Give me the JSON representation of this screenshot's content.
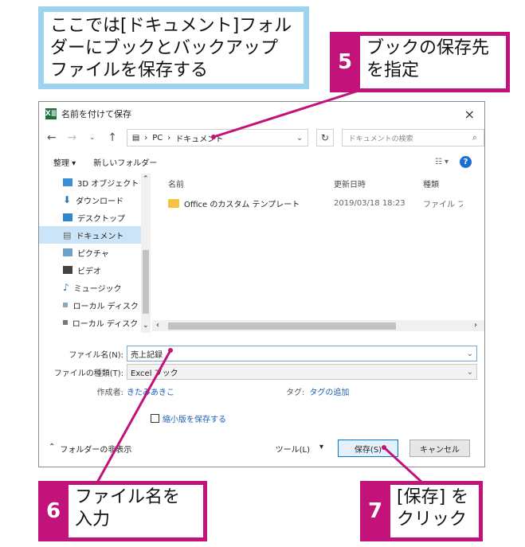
{
  "intro": {
    "line1": "ここでは[ドキュメント]フォル",
    "line2": "ダーにブックとバックアップ",
    "line3": "ファイルを保存する"
  },
  "steps": {
    "s5": {
      "num": "5",
      "line1": "ブックの保存先",
      "line2": "を指定"
    },
    "s6": {
      "num": "6",
      "line1": "ファイル名を",
      "line2": "入力"
    },
    "s7": {
      "num": "7",
      "line1": "[保存] を",
      "line2": "クリック"
    }
  },
  "dialog": {
    "app_icon": "X≣",
    "title": "名前を付けて保存",
    "close": "×",
    "address": {
      "crumbs": [
        "PC",
        "ドキュメント"
      ],
      "sep": "›"
    },
    "search_placeholder": "ドキュメントの検索",
    "command": {
      "organize": "整理 ▾",
      "new_folder": "新しいフォルダー",
      "view": "☷ ▾",
      "help": "?"
    },
    "nav_items": [
      "3D オブジェクト",
      "ダウンロード",
      "デスクトップ",
      "ドキュメント",
      "ピクチャ",
      "ビデオ",
      "ミュージック",
      "ローカル ディスク (C",
      "ローカル ディスク (D"
    ],
    "columns": {
      "name": "名前",
      "date": "更新日時",
      "type": "種類"
    },
    "files": [
      {
        "name": "Office のカスタム テンプレート",
        "date": "2019/03/18 18:23",
        "type": "ファイル フォ"
      }
    ],
    "filename_label": "ファイル名(N):",
    "filename_value": "売上記録",
    "filetype_label": "ファイルの種類(T):",
    "filetype_value": "Excel ブック",
    "author_label": "作成者:",
    "author_value": "きたみあきこ",
    "tags_label": "タグ:",
    "tags_value": "タグの追加",
    "thumbnail_label": "縮小版を保存する",
    "hide_folders": "フォルダーの非表示",
    "tools": "ツール(L)",
    "save": "保存(S)",
    "cancel": "キャンセル"
  }
}
